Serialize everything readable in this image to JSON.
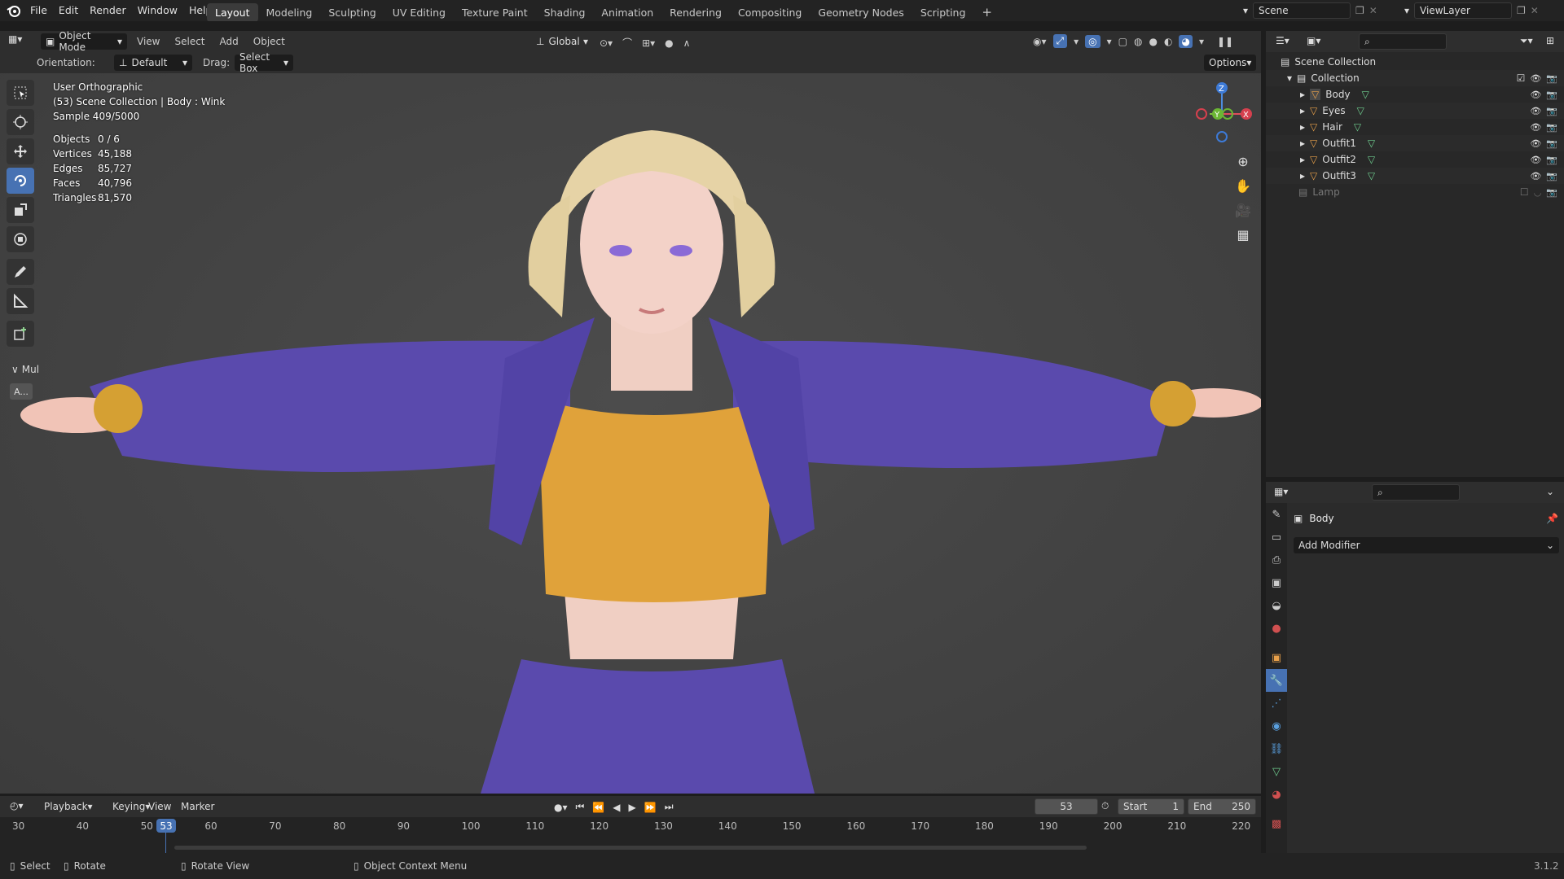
{
  "topbar": {
    "menus": [
      "File",
      "Edit",
      "Render",
      "Window",
      "Help"
    ],
    "workspaces": [
      "Layout",
      "Modeling",
      "Sculpting",
      "UV Editing",
      "Texture Paint",
      "Shading",
      "Animation",
      "Rendering",
      "Compositing",
      "Geometry Nodes",
      "Scripting"
    ],
    "active_workspace": "Layout",
    "scene": "Scene",
    "view_layer": "ViewLayer"
  },
  "viewport_header": {
    "mode": "Object Mode",
    "menus": [
      "View",
      "Select",
      "Add",
      "Object"
    ],
    "transform_orientation": "Global"
  },
  "tool_header": {
    "orientation_label": "Orientation:",
    "orientation_value": "Default",
    "drag_label": "Drag:",
    "drag_value": "Select Box",
    "options": "Options"
  },
  "overlay": {
    "view_name": "User Orthographic",
    "context": "(53) Scene Collection | Body : Wink",
    "sample": "Sample 409/5000",
    "stats": [
      {
        "k": "Objects",
        "v": "0 / 6"
      },
      {
        "k": "Vertices",
        "v": "45,188"
      },
      {
        "k": "Edges",
        "v": "85,727"
      },
      {
        "k": "Faces",
        "v": "40,796"
      },
      {
        "k": "Triangles",
        "v": "81,570"
      }
    ]
  },
  "side_panel": {
    "collapsed_label": "Mul",
    "button": "A..."
  },
  "gizmo": {
    "x": "X",
    "y": "Y",
    "z": "Z"
  },
  "outliner": {
    "root": "Scene Collection",
    "collection": "Collection",
    "objects": [
      "Body",
      "Eyes",
      "Hair",
      "Outfit1",
      "Outfit2",
      "Outfit3"
    ],
    "lamp": "Lamp"
  },
  "properties": {
    "object_name": "Body",
    "add_modifier": "Add Modifier"
  },
  "timeline": {
    "menus": [
      "Playback",
      "Keying",
      "View",
      "Marker"
    ],
    "current_frame": "53",
    "start_label": "Start",
    "start": "1",
    "end_label": "End",
    "end": "250",
    "ticks": [
      "30",
      "40",
      "50",
      "60",
      "70",
      "80",
      "90",
      "100",
      "110",
      "120",
      "130",
      "140",
      "150",
      "160",
      "170",
      "180",
      "190",
      "200",
      "210",
      "220"
    ],
    "frame_marker": "53"
  },
  "statusbar": {
    "select": "Select",
    "rotate": "Rotate",
    "rotate_view": "Rotate View",
    "context_menu": "Object Context Menu",
    "version": "3.1.2"
  },
  "colors": {
    "accent": "#4772b3",
    "object_orange": "#e8a04a",
    "mesh_green": "#6fce8f"
  }
}
